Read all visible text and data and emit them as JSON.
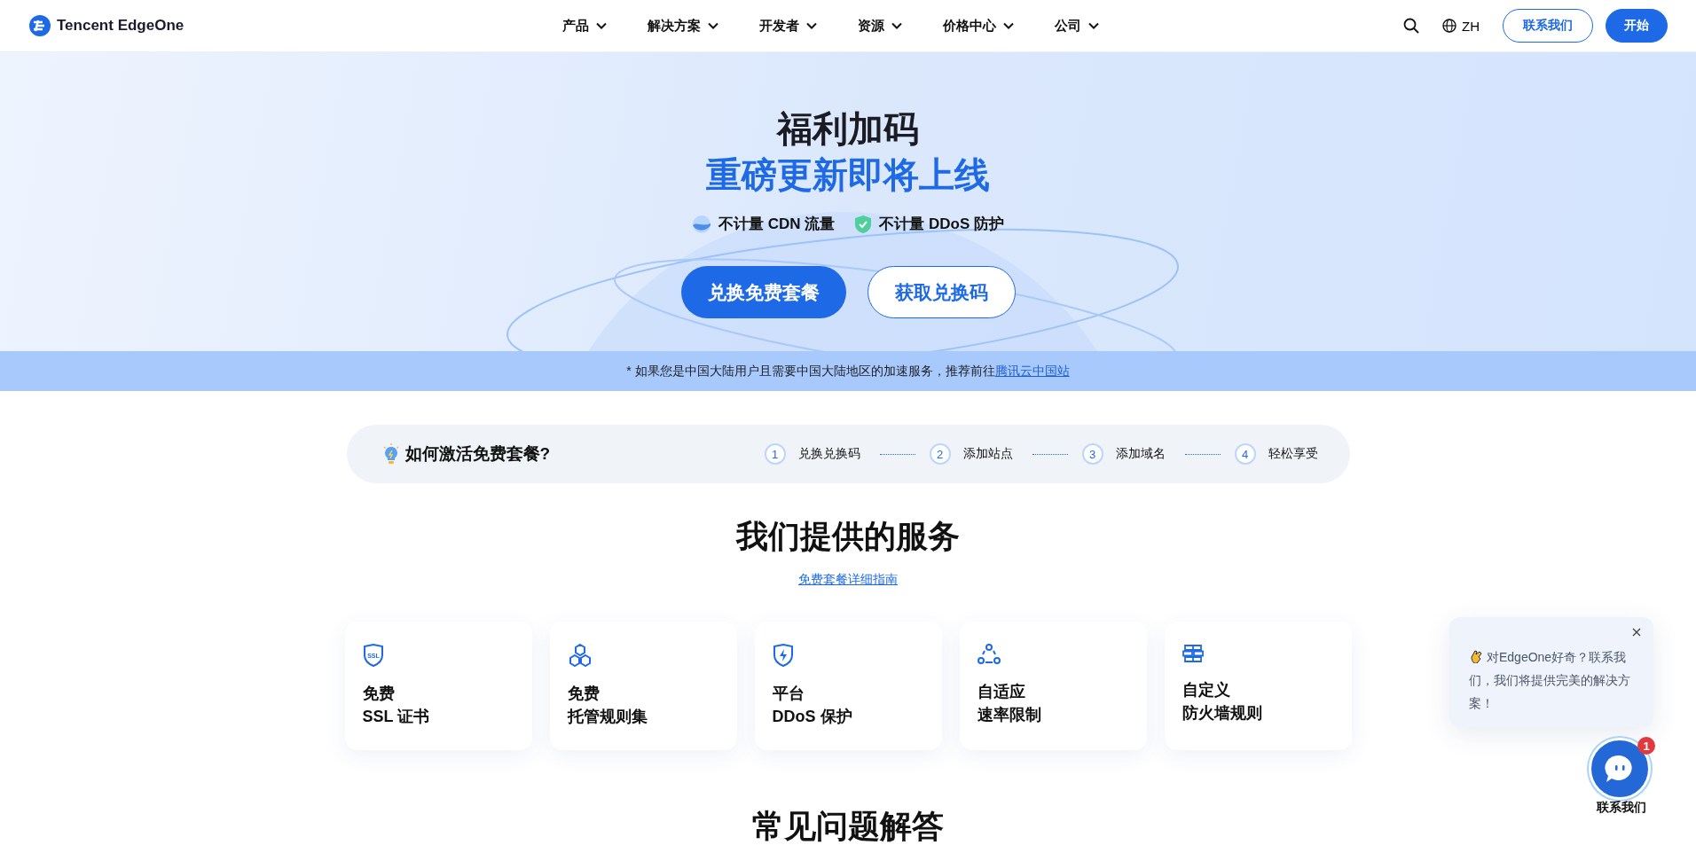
{
  "header": {
    "logo": "Tencent EdgeOne",
    "nav": [
      {
        "label": "产品"
      },
      {
        "label": "解决方案"
      },
      {
        "label": "开发者"
      },
      {
        "label": "资源"
      },
      {
        "label": "价格中心"
      },
      {
        "label": "公司"
      }
    ],
    "language": "ZH",
    "buttons": [
      {
        "kind": "outline",
        "label": "联系我们"
      },
      {
        "kind": "solid",
        "label": "开始"
      }
    ]
  },
  "hero": {
    "title": "福利加码",
    "subtitle": "重磅更新即将上线",
    "features": [
      {
        "kind": "cdn",
        "label": "不计量 CDN 流量"
      },
      {
        "kind": "ddos",
        "label": "不计量 DDoS 防护"
      }
    ],
    "buttons": [
      {
        "kind": "primary",
        "label": "兑换免费套餐"
      },
      {
        "kind": "secondary",
        "label": "获取兑换码"
      }
    ]
  },
  "notice": {
    "text": "* 如果您是中国大陆用户且需要中国大陆地区的加速服务，推荐前往",
    "link": "腾讯云中国站"
  },
  "activation": {
    "title": "如何激活免费套餐?",
    "steps": [
      {
        "number": "1",
        "label": "兑换兑换码"
      },
      {
        "number": "2",
        "label": "添加站点"
      },
      {
        "number": "3",
        "label": "添加域名"
      },
      {
        "number": "4",
        "label": "轻松享受"
      }
    ]
  },
  "services": {
    "title": "我们提供的服务",
    "guide_link": "免费套餐详细指南",
    "cards": [
      {
        "kind": "ssl",
        "icon_text": "SSL",
        "line_1": "免费",
        "line_2": "SSL 证书"
      },
      {
        "kind": "rules",
        "line_1": "免费",
        "line_2": "托管规则集"
      },
      {
        "kind": "ddos",
        "line_1": "平台",
        "line_2": "DDoS 保护"
      },
      {
        "kind": "rate",
        "line_1": "自适应",
        "line_2": "速率限制"
      },
      {
        "kind": "firewall",
        "line_1": "自定义",
        "line_2": "防火墙规则"
      }
    ]
  },
  "faq": {
    "title": "常见问题解答"
  },
  "chat": {
    "message": "对EdgeOne好奇？联系我们，我们将提供完美的解决方案！",
    "badge": "1",
    "label": "联系我们"
  }
}
